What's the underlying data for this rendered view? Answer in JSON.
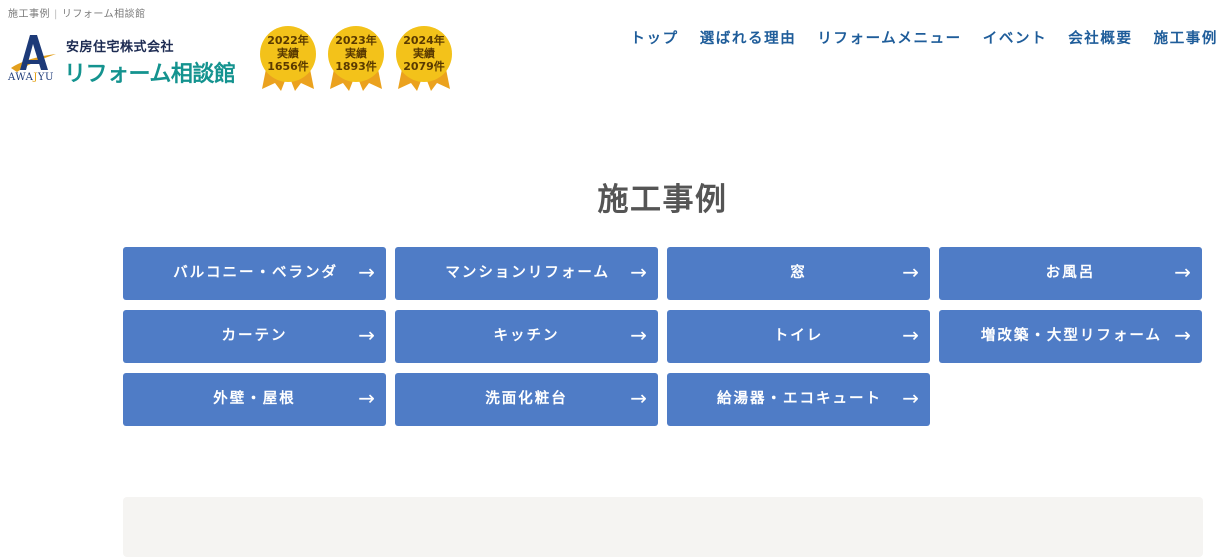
{
  "topbar": {
    "crumb1": "施工事例",
    "crumb2": "リフォーム相談館"
  },
  "logo": {
    "company": "安房住宅株式会社",
    "brand": "リフォーム相談館",
    "wordmark_a": "AWA",
    "wordmark_j": "J",
    "wordmark_yu": "YU"
  },
  "badges": [
    {
      "year": "2022年",
      "label": "実績",
      "count": "1656件"
    },
    {
      "year": "2023年",
      "label": "実績",
      "count": "1893件"
    },
    {
      "year": "2024年",
      "label": "実績",
      "count": "2079件"
    }
  ],
  "nav": [
    {
      "label": "トップ"
    },
    {
      "label": "選ばれる理由"
    },
    {
      "label": "リフォームメニュー"
    },
    {
      "label": "イベント"
    },
    {
      "label": "会社概要"
    },
    {
      "label": "施工事例"
    }
  ],
  "page": {
    "title": "施工事例"
  },
  "categories": [
    {
      "label": "バルコニー・ベランダ"
    },
    {
      "label": "マンションリフォーム"
    },
    {
      "label": "窓"
    },
    {
      "label": "お風呂"
    },
    {
      "label": "カーテン"
    },
    {
      "label": "キッチン"
    },
    {
      "label": "トイレ"
    },
    {
      "label": "増改築・大型リフォーム"
    },
    {
      "label": "外壁・屋根"
    },
    {
      "label": "洗面化粧台"
    },
    {
      "label": "給湯器・エコキュート"
    }
  ],
  "arrow_glyph": "→",
  "colors": {
    "button": "#4f7cc6",
    "nav_text": "#1f5d9a",
    "brand_teal": "#14938f",
    "badge_gold": "#f3c21a",
    "badge_ribbon": "#eba21e"
  }
}
